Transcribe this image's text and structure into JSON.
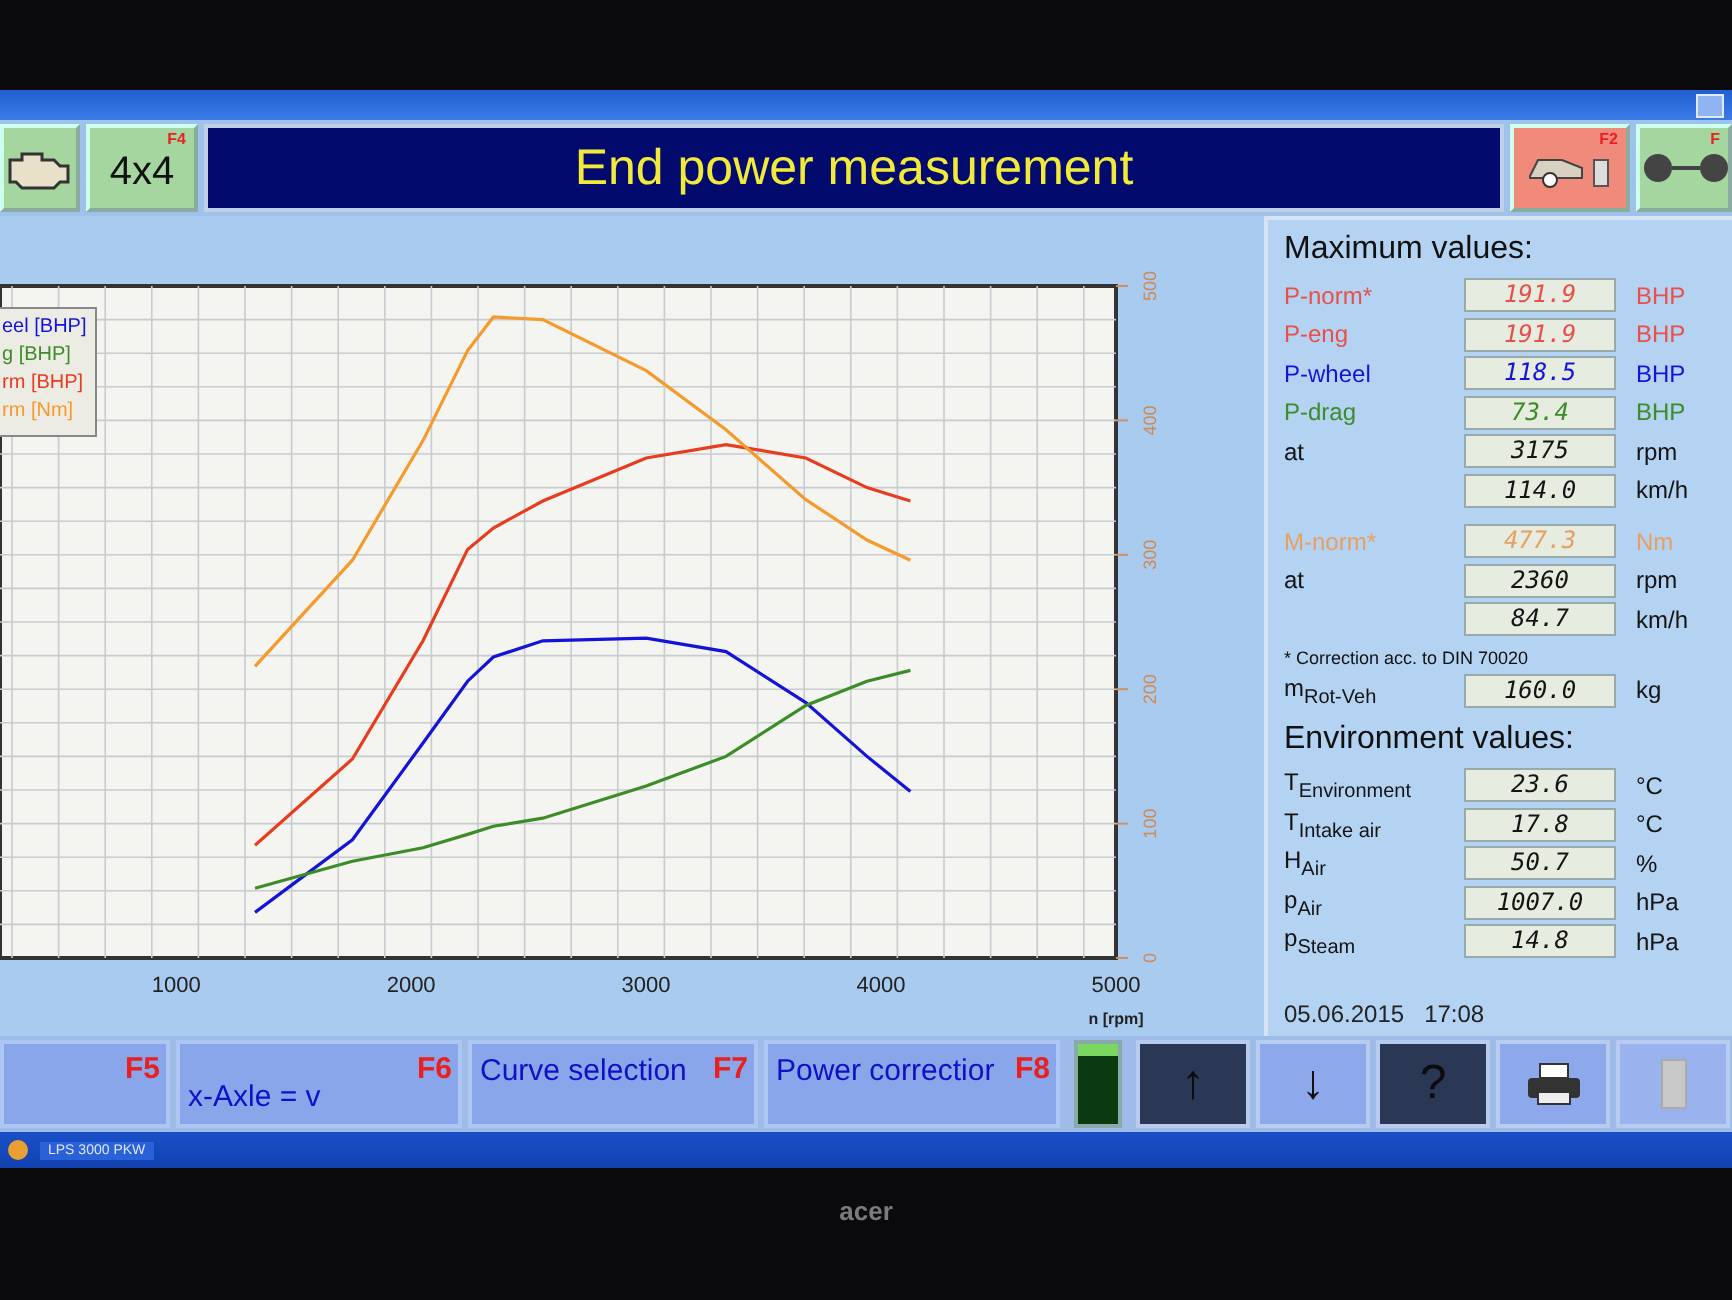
{
  "header": {
    "mode_button": {
      "label": "4x4",
      "fkey": "F4"
    },
    "title": "End power measurement",
    "right_buttons": [
      {
        "kind": "car",
        "fkey": "F2"
      },
      {
        "kind": "dumbbell",
        "fkey": "F"
      }
    ]
  },
  "chart": {
    "chart_data": {
      "type": "line",
      "grid": true,
      "xlabel": "n [rpm]",
      "x": [
        1335,
        1750,
        2050,
        2240,
        2350,
        2560,
        3000,
        3340,
        3680,
        3940,
        4125
      ],
      "xlim": [
        250,
        5000
      ],
      "xticks": [
        1000,
        2000,
        3000,
        4000,
        5000
      ],
      "ylim": [
        0,
        500
      ],
      "yticks": [
        0,
        100,
        200,
        300,
        400,
        500
      ],
      "series": [
        {
          "name": "eel [BHP]",
          "color": "#1414d8",
          "values": [
            34,
            88,
            160,
            206,
            224,
            236,
            238,
            228,
            190,
            150,
            124
          ]
        },
        {
          "name": "g [BHP]",
          "color": "#3c8c28",
          "values": [
            52,
            72,
            82,
            92,
            98,
            104,
            128,
            150,
            188,
            206,
            214
          ]
        },
        {
          "name": "rm [BHP]",
          "color": "#e83c1e",
          "values": [
            84,
            148,
            236,
            304,
            320,
            340,
            372,
            382,
            372,
            350,
            340
          ]
        },
        {
          "name": "rm [Nm]",
          "color": "#f59a2c",
          "values": [
            217,
            296,
            385,
            452,
            477,
            475,
            437,
            393,
            341,
            311,
            296
          ]
        }
      ]
    }
  },
  "max_values": {
    "title": "Maximum values:",
    "rows": [
      {
        "label": "P-norm*",
        "value": "191.9",
        "unit": "BHP",
        "color": "#e8504a"
      },
      {
        "label": "P-eng",
        "value": "191.9",
        "unit": "BHP",
        "color": "#e8504a"
      },
      {
        "label": "P-wheel",
        "value": "118.5",
        "unit": "BHP",
        "color": "#1414d8"
      },
      {
        "label": "P-drag",
        "value": "73.4",
        "unit": "BHP",
        "color": "#3c8c28"
      },
      {
        "label": "at",
        "value": "3175",
        "unit": "rpm",
        "color": "#141414"
      },
      {
        "value": "114.0",
        "unit": "km/h",
        "color": "#141414"
      }
    ],
    "torque_rows": [
      {
        "label": "M-norm*",
        "value": "477.3",
        "unit": "Nm",
        "color": "#e8a060"
      },
      {
        "label": "at",
        "value": "2360",
        "unit": "rpm",
        "color": "#141414"
      },
      {
        "value": "84.7",
        "unit": "km/h",
        "color": "#141414"
      }
    ],
    "note": "* Correction acc. to DIN 70020",
    "mass_row": {
      "label": "m$_{Rot-Veh}$",
      "value": "160.0",
      "unit": "kg"
    }
  },
  "environment": {
    "title": "Environment values:",
    "rows": [
      {
        "label": "T$_{Environment}$",
        "value": "23.6",
        "unit": "°C"
      },
      {
        "label": "T$_{Intake air}$",
        "value": "17.8",
        "unit": "°C"
      },
      {
        "label": "H$_{Air}$",
        "value": "50.7",
        "unit": "%"
      },
      {
        "label": "p$_{Air}$",
        "value": "1007.0",
        "unit": "hPa"
      },
      {
        "label": "p$_{Steam}$",
        "value": "14.8",
        "unit": "hPa"
      }
    ]
  },
  "timestamp": {
    "date": "05.06.2015",
    "time": "17:08"
  },
  "function_buttons": [
    {
      "fkey": "F5"
    },
    {
      "label": "x-Axle = v",
      "fkey": "F6"
    },
    {
      "label": "Curve selection",
      "fkey": "F7"
    },
    {
      "label": "Power correctior",
      "fkey": "F8"
    }
  ],
  "tool_buttons": [
    {
      "kind": "dark",
      "label": "↑"
    },
    {
      "kind": "light",
      "label": "↓"
    },
    {
      "kind": "dark",
      "label": "?"
    },
    {
      "kind": "print"
    },
    {
      "kind": "disabled"
    }
  ],
  "taskbar": {
    "items": [
      {
        "label": "LPS 3000 PKW"
      }
    ]
  },
  "monitor": {
    "brand": "acer"
  }
}
